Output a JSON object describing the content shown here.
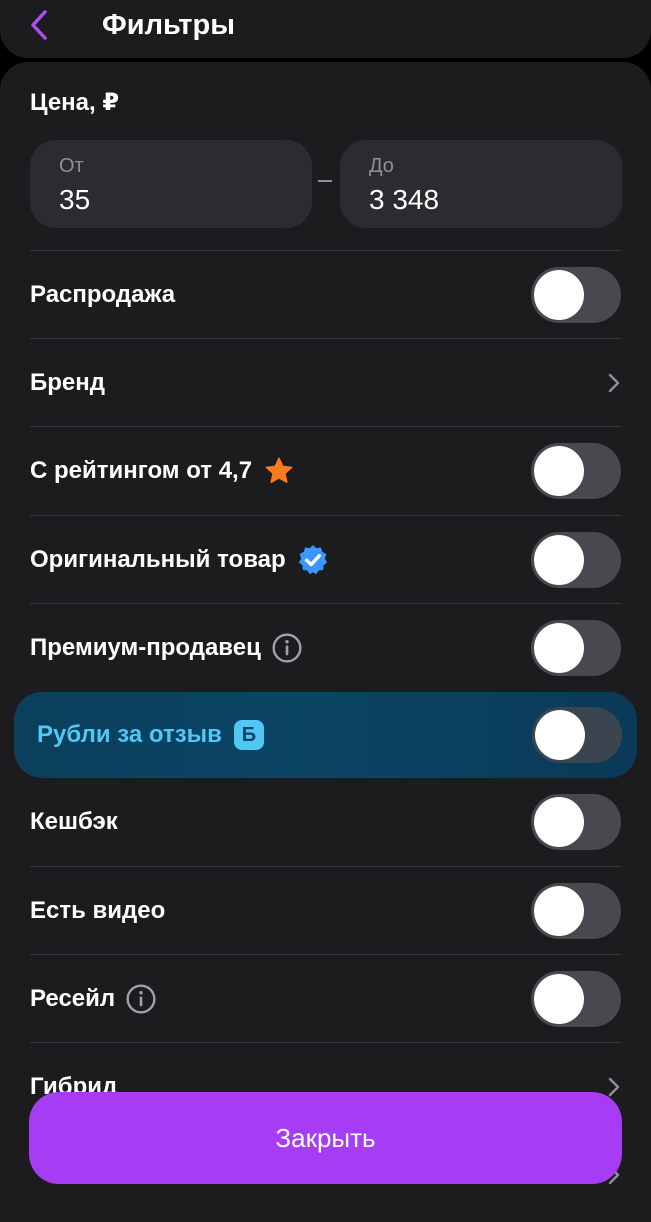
{
  "header": {
    "title": "Фильтры"
  },
  "price": {
    "label": "Цена, ₽",
    "from": {
      "label": "От",
      "value": "35"
    },
    "to": {
      "label": "До",
      "value": "3 348"
    }
  },
  "rows": [
    {
      "label": "Распродажа",
      "control": "toggle",
      "on": false
    },
    {
      "label": "Бренд",
      "control": "chevron"
    },
    {
      "label": "С рейтингом от 4,7",
      "control": "toggle",
      "on": false,
      "icon": "star-icon"
    },
    {
      "label": "Оригинальный товар",
      "control": "toggle",
      "on": false,
      "icon": "verified-badge-icon"
    },
    {
      "label": "Премиум-продавец",
      "control": "toggle",
      "on": false,
      "icon": "info-icon"
    },
    {
      "label": "Рубли за отзыв",
      "control": "toggle",
      "on": false,
      "badge": "Б"
    },
    {
      "label": "Кешбэк",
      "control": "toggle",
      "on": false
    },
    {
      "label": "Есть видео",
      "control": "toggle",
      "on": false
    },
    {
      "label": "Ресейл",
      "control": "toggle",
      "on": false,
      "icon": "info-icon"
    },
    {
      "label": "Гибрид",
      "control": "chevron"
    }
  ],
  "close_button": {
    "label": "Закрыть"
  },
  "colors": {
    "accent": "#a63df5",
    "promo_text": "#52c7f5",
    "star": "#ff7a1a",
    "verified": "#3a97ff",
    "background": "#1c1c1e"
  }
}
